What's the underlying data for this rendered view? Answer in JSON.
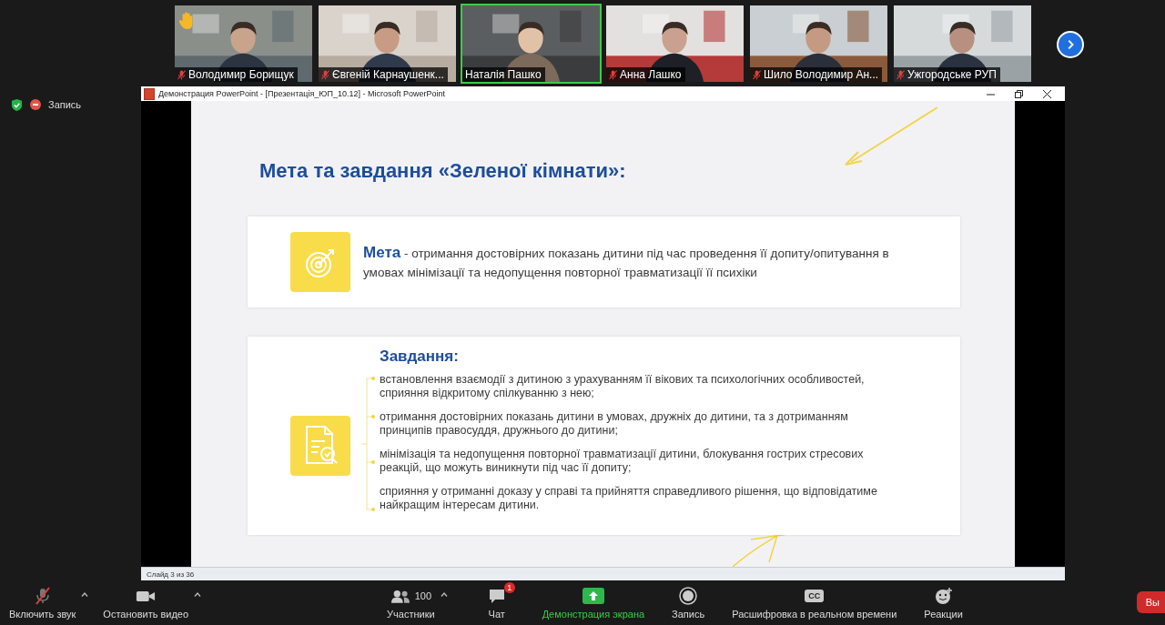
{
  "participants": [
    {
      "name": "Володимир Борищук",
      "muted": true,
      "speaking": false,
      "hand_raised": true
    },
    {
      "name": "Євгеній Карнаушенк...",
      "muted": true,
      "speaking": false,
      "hand_raised": false
    },
    {
      "name": "Наталія Пашко",
      "muted": false,
      "speaking": true,
      "hand_raised": false
    },
    {
      "name": "Анна Лашко",
      "muted": true,
      "speaking": false,
      "hand_raised": false
    },
    {
      "name": "Шило Володимир Ан...",
      "muted": true,
      "speaking": false,
      "hand_raised": false
    },
    {
      "name": "Ужгородське РУП",
      "muted": true,
      "speaking": false,
      "hand_raised": false
    }
  ],
  "recording": {
    "label": "Запись"
  },
  "window": {
    "title": "Демонстрация PowerPoint - [Презентація_ЮП_10.12] - Microsoft PowerPoint",
    "status": "Слайд 3 из 36"
  },
  "slide": {
    "title": "Мета та завдання  «Зеленої кімнати»:",
    "goal": {
      "text": "**Мета** - отримання достовірних показань дитини під час проведення її допиту/опитування в умовах мінімізації та недопущення повторної травматизації її психіки"
    },
    "tasks": {
      "heading": "Завдання:",
      "items": [
        "встановлення взаємодії з дитиною з урахуванням її вікових та психологічних особливостей, сприяння відкритому спілкуванню з нею;",
        "отримання достовірних показань дитини в умовах, дружніх до дитини, та з дотриманням принципів правосуддя, дружнього до дитини;",
        "мінімізація та недопущення повторної травматизації дитини, блокування гострих стресових реакцій, що можуть виникнути під час її допиту;",
        "сприяння у отриманні доказу у справі та прийняття справедливого рішення, що відповідатиме найкращим інтересам дитини."
      ]
    }
  },
  "toolbar": {
    "items": [
      {
        "kind": "mic",
        "label": "Включить звук",
        "muted": true
      },
      {
        "kind": "video",
        "label": "Остановить видео"
      },
      {
        "kind": "participants",
        "label": "Участники",
        "count": "100"
      },
      {
        "kind": "chat",
        "label": "Чат",
        "badge": "1"
      },
      {
        "kind": "share",
        "label": "Демонстрация экрана"
      },
      {
        "kind": "record",
        "label": "Запись"
      },
      {
        "kind": "cc",
        "label": "Расшифровка в реальном времени",
        "icon_text": "CC"
      },
      {
        "kind": "reactions",
        "label": "Реакции"
      }
    ],
    "leave": "Вы"
  }
}
